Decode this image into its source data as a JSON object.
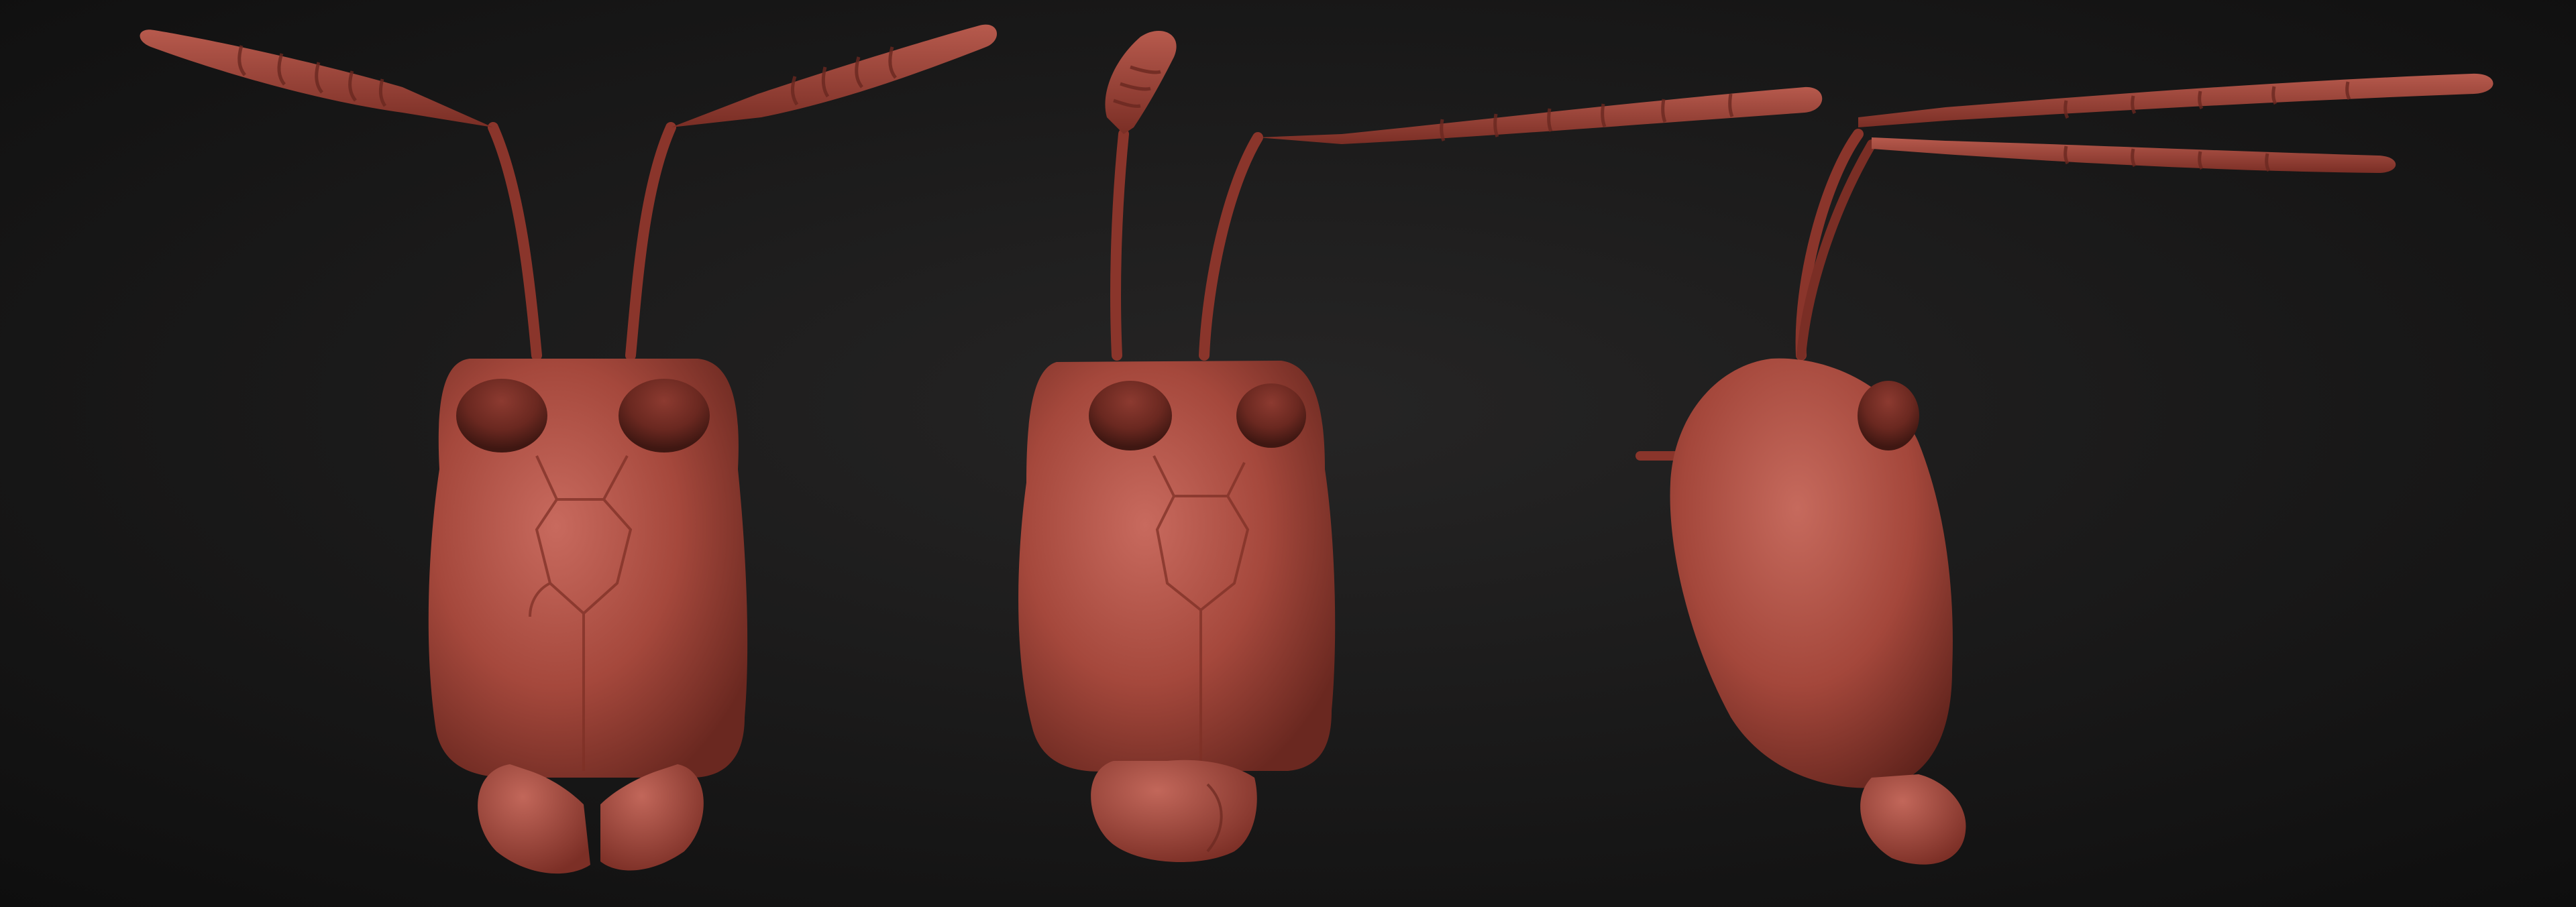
{
  "scene": {
    "views": [
      {
        "view": "front"
      },
      {
        "view": "three-quarter"
      },
      {
        "view": "side"
      }
    ]
  },
  "colors": {
    "background_center": "#252424",
    "background_edge": "#0f0f0f",
    "clay_light": "#c4665a",
    "clay_mid": "#a5483c",
    "clay_dark": "#6e2a22",
    "clay_deep": "#4a1a15"
  }
}
